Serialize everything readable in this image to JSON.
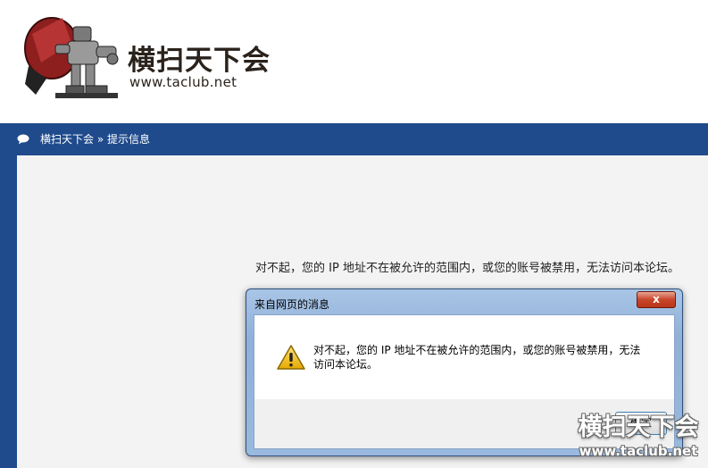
{
  "header": {
    "site_name": "横扫天下会",
    "site_url": "www.taclub.net"
  },
  "nav": {
    "breadcrumb_home": "横扫天下会",
    "breadcrumb_separator": "»",
    "breadcrumb_current": "提示信息"
  },
  "main": {
    "message": "对不起，您的 IP 地址不在被允许的范围内，或您的账号被禁用，无法访问本论坛。"
  },
  "dialog": {
    "title": "来自网页的消息",
    "close_label": "x",
    "message_line1": "对不起，您的 IP 地址不在被允许的范围内，或您的账号被禁用，无法",
    "message_line2": "访问本论坛。",
    "ok_label": "确定"
  },
  "watermark": {
    "text": "横扫天下会",
    "url": "www.taclub.net"
  },
  "colors": {
    "nav_bg": "#1f4b8d",
    "content_bg": "#f3f3f3"
  }
}
